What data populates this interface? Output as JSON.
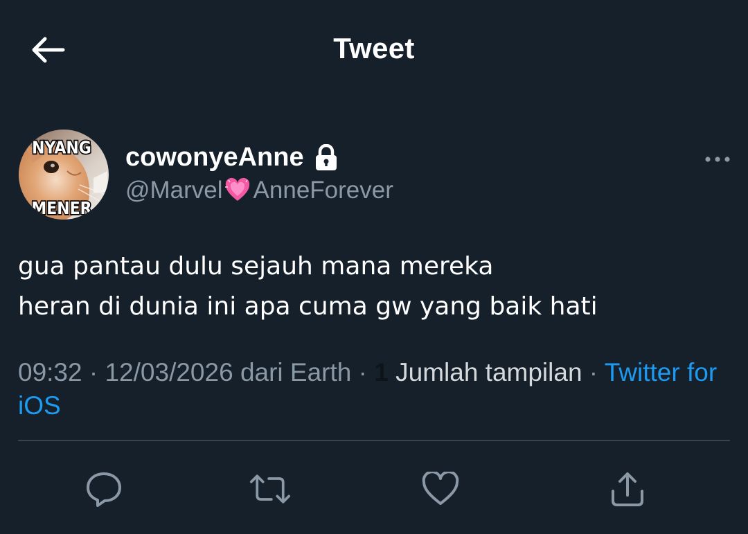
{
  "header": {
    "title": "Tweet",
    "back_icon": "arrow-left-icon"
  },
  "tweet": {
    "avatar": {
      "top_text": "NYANG",
      "bottom_text": "MENER"
    },
    "display_name": "cowonyeAnne",
    "protected_icon": "lock-icon",
    "handle_prefix": "@Marvel",
    "handle_emoji": "pink-heart-icon",
    "handle_suffix": "AnneForever",
    "more_icon": "more-dots-icon",
    "text_lines": [
      "gua pantau dulu sejauh mana mereka",
      "heran di dunia ini apa cuma gw yang baik hati"
    ],
    "meta": {
      "time": "09:32",
      "separator": " · ",
      "date": "12/03/2026",
      "location": " dari Earth",
      "views_count": "1",
      "views_label": " Jumlah tampilan",
      "source": "Twitter for iOS"
    }
  },
  "actions": {
    "reply": "reply-icon",
    "retweet": "retweet-icon",
    "like": "heart-icon",
    "share": "share-icon"
  },
  "colors": {
    "background": "#15202b",
    "secondary_text": "#8b98a5",
    "accent": "#1d9bf0",
    "divider": "#38444d"
  }
}
